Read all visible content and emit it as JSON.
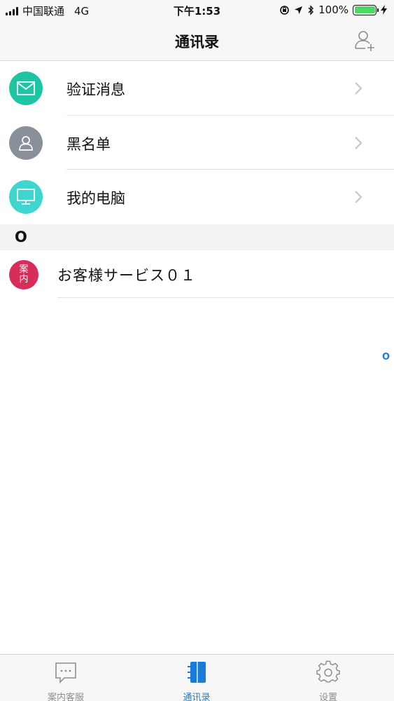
{
  "status_bar": {
    "carrier": "中国联通",
    "network": "4G",
    "time": "下午1:53",
    "battery": "100%",
    "battery_level": 1.0
  },
  "nav": {
    "title": "通讯录",
    "right_icon": "add-contact-icon"
  },
  "functions": [
    {
      "label": "验证消息",
      "icon": "envelope-icon",
      "color": "#1ec5a4"
    },
    {
      "label": "黑名单",
      "icon": "person-icon",
      "color": "#8a9099"
    },
    {
      "label": "我的电脑",
      "icon": "monitor-icon",
      "color": "#3fd6cf"
    }
  ],
  "section": {
    "letter": "O"
  },
  "contacts": [
    {
      "name": "お客様サービス０１",
      "avatar_line1": "案",
      "avatar_line2": "内"
    }
  ],
  "index": [
    "O"
  ],
  "tabs": [
    {
      "label": "案内客服",
      "icon": "chat-bubble-icon",
      "active": false
    },
    {
      "label": "通讯录",
      "icon": "address-book-icon",
      "active": true
    },
    {
      "label": "设置",
      "icon": "gear-icon",
      "active": false
    }
  ],
  "colors": {
    "accent": "#1a7cd8",
    "battery_green": "#4cd964",
    "avatar": "#d62d5a"
  }
}
